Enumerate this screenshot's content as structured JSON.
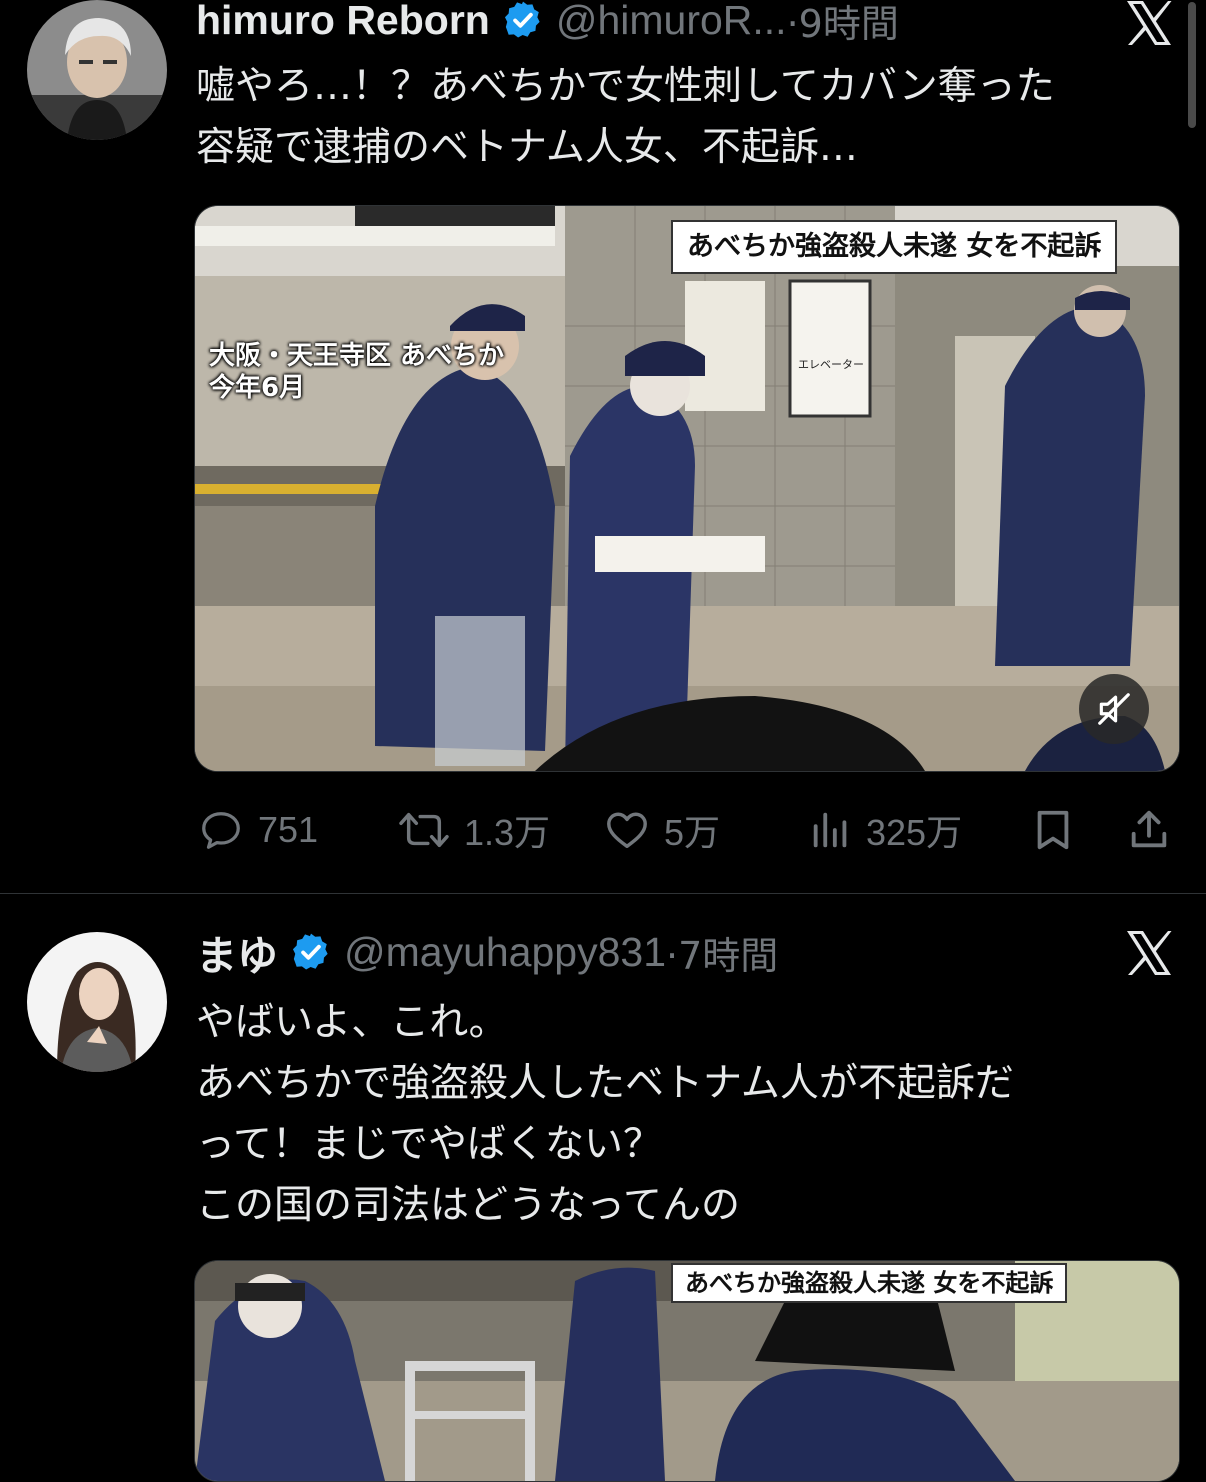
{
  "tweets": [
    {
      "display_name": "himuro Reborn",
      "handle": "@himuroR...",
      "time": "·9時間",
      "text_lines": [
        "嘘やろ…！？あべちかで女性刺してカバン奪った",
        "容疑で逮捕のベトナム人女、不起訴…"
      ],
      "media": {
        "caption": "あべちか強盗殺人未遂  女を不起訴",
        "location_lines": [
          "大阪・天王寺区 あべちか",
          "今年6月"
        ],
        "sign_label": "エレベーター"
      },
      "stats": {
        "replies": "751",
        "reposts": "1.3万",
        "likes": "5万",
        "views": "325万"
      }
    },
    {
      "display_name": "まゆ",
      "handle": "@mayuhappy831",
      "time": "·7時間",
      "text_lines": [
        "やばいよ、これ。",
        "あべちかで強盗殺人したベトナム人が不起訴だ",
        "って！まじでやばくない？",
        "この国の司法はどうなってんの"
      ],
      "media": {
        "caption": "あべちか強盗殺人未遂  女を不起訴"
      }
    }
  ],
  "icons": {
    "verified": "verified-badge-icon",
    "x_logo": "x-logo-icon",
    "reply": "reply-icon",
    "repost": "repost-icon",
    "like": "heart-icon",
    "views": "views-icon",
    "bookmark": "bookmark-icon",
    "share": "share-icon",
    "mute": "mute-icon"
  },
  "colors": {
    "background": "#000000",
    "text": "#e7e9ea",
    "secondary": "#71767b",
    "verified": "#1d9bf0",
    "divider": "#2f3336"
  }
}
